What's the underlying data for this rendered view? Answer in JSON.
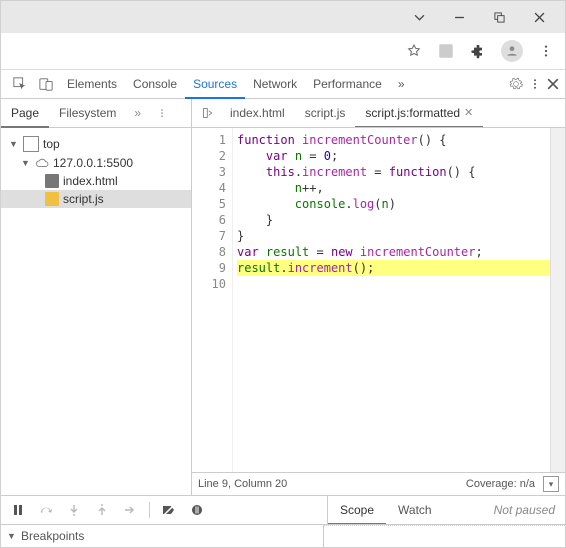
{
  "devtools_tabs": [
    "Elements",
    "Console",
    "Sources",
    "Network",
    "Performance"
  ],
  "devtools_active_tab": "Sources",
  "nav_tabs": [
    "Page",
    "Filesystem"
  ],
  "nav_active": "Page",
  "file_tabs": [
    {
      "label": "index.html",
      "active": false,
      "closable": false
    },
    {
      "label": "script.js",
      "active": false,
      "closable": false
    },
    {
      "label": "script.js:formatted",
      "active": true,
      "closable": true
    }
  ],
  "tree": {
    "top": "top",
    "origin": "127.0.0.1:5500",
    "files": [
      "index.html",
      "script.js"
    ],
    "selected": "script.js"
  },
  "code_lines": 10,
  "highlight_line": 9,
  "statusbar": {
    "pos": "Line 9, Column 20",
    "coverage": "Coverage: n/a"
  },
  "debug_tabs": [
    "Scope",
    "Watch"
  ],
  "debug_active": "Scope",
  "paused_text": "Not paused",
  "breakpoints_label": "Breakpoints",
  "chart_data": {
    "type": "code",
    "language": "javascript",
    "highlight_line": 9,
    "lines": [
      "function incrementCounter() {",
      "    var n = 0;",
      "    this.increment = function() {",
      "        n++,",
      "        console.log(n)",
      "    }",
      "}",
      "var result = new incrementCounter;",
      "result.increment();",
      ""
    ]
  }
}
